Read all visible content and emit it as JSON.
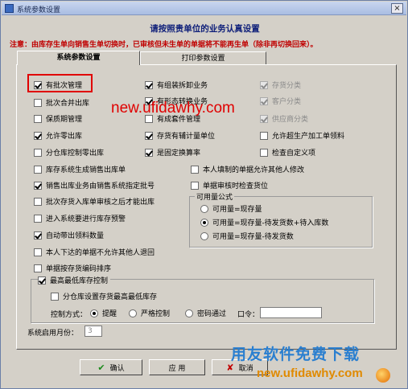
{
  "window": {
    "title": "系统参数设置",
    "close_label": "×"
  },
  "heading": "请按照贵单位的业务认真设置",
  "notice": "注意：由库存生单向销售生单切换时，已审核但未生单的单据将不能再生单（除非再切换回来）。",
  "tabs": [
    {
      "label": "系统参数设置"
    },
    {
      "label": "打印参数设置"
    }
  ],
  "col1": [
    {
      "label": "有批次管理",
      "checked": true
    },
    {
      "label": "批次合并出库",
      "checked": false
    },
    {
      "label": "保质期管理",
      "checked": false
    },
    {
      "label": "允许零出库",
      "checked": true
    },
    {
      "label": "分仓库控制零出库",
      "checked": false
    },
    {
      "label": "库存系统生成销售出库单",
      "checked": false
    },
    {
      "label": "销售出库业务由销售系统指定批号",
      "checked": true
    },
    {
      "label": "批次存货入库单审核之后才能出库",
      "checked": false
    },
    {
      "label": "进入系统要进行库存预警",
      "checked": false
    },
    {
      "label": "自动带出领料数量",
      "checked": true
    },
    {
      "label": "本人下达的单据不允许其他人退回",
      "checked": false
    },
    {
      "label": "单据按存货编码排序",
      "checked": false
    }
  ],
  "col2": [
    {
      "label": "有组装拆卸业务",
      "checked": true
    },
    {
      "label": "有形态转换业务",
      "checked": true
    },
    {
      "label": "有成套件管理",
      "checked": false
    },
    {
      "label": "存货有辅计量单位",
      "checked": true
    },
    {
      "label": "是固定换算率",
      "checked": true
    },
    {
      "label": "本人填制的单据允许其他人修改",
      "checked": false
    },
    {
      "label": "单据审核时检查货位",
      "checked": false
    }
  ],
  "col3": [
    {
      "label": "存货分类",
      "checked": true,
      "disabled": true
    },
    {
      "label": "客户分类",
      "checked": true,
      "disabled": true
    },
    {
      "label": "供应商分类",
      "checked": true,
      "disabled": true
    },
    {
      "label": "允许超生产加工单领料",
      "checked": false
    },
    {
      "label": "检查自定义项",
      "checked": false
    }
  ],
  "available_qty": {
    "title": "可用量公式",
    "options": [
      {
        "label": "可用量=现存量",
        "selected": false
      },
      {
        "label": "可用量=现存量-待发货数+待入库数",
        "selected": true
      },
      {
        "label": "可用量=现存量-待发货数",
        "selected": false
      }
    ]
  },
  "stock_control": {
    "title": "最高最低库存控制",
    "title_checked": true,
    "by_warehouse": {
      "label": "分仓库设置存货最高最低库存",
      "checked": false
    },
    "method_label": "控制方式：",
    "methods": [
      {
        "label": "提醒",
        "selected": true
      },
      {
        "label": "严格控制",
        "selected": false
      },
      {
        "label": "密码通过",
        "selected": false
      }
    ],
    "password_label": "口令："
  },
  "start_month": {
    "label": "系统启用月份：",
    "value": "3"
  },
  "buttons": [
    {
      "label": "确认",
      "icon": "✔"
    },
    {
      "label": "应 用"
    },
    {
      "label": "取消",
      "icon": "✘"
    }
  ],
  "watermarks": {
    "url_top": "new.ufidawhy.com",
    "brand": "用友软件免费下载",
    "url_bottom": "new.ufidawhy.com"
  },
  "colors": {
    "notice": "#c00000",
    "heading": "#10207a",
    "highlight": "#e00000"
  }
}
